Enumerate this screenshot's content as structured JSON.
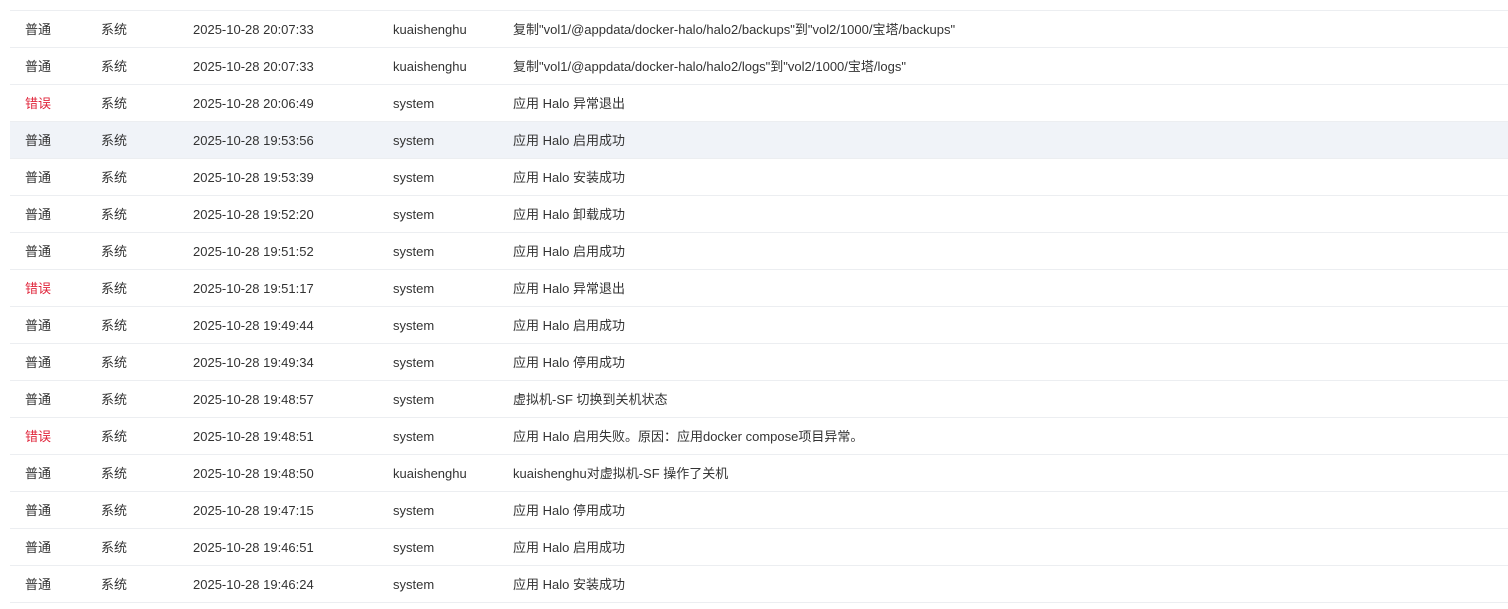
{
  "colors": {
    "error_level": "#e0243a",
    "row_hover": "#f0f3f8",
    "divider": "#eceef1",
    "text": "#333333"
  },
  "log": {
    "rows": [
      {
        "level": "普通",
        "type": "系统",
        "time": "2025-10-28 20:07:33",
        "user": "kuaishenghu",
        "message": "复制\"vol1/@appdata/docker-halo/halo2/backups\"到\"vol2/1000/宝塔/backups\"",
        "is_error": false,
        "hover": false
      },
      {
        "level": "普通",
        "type": "系统",
        "time": "2025-10-28 20:07:33",
        "user": "kuaishenghu",
        "message": "复制\"vol1/@appdata/docker-halo/halo2/logs\"到\"vol2/1000/宝塔/logs\"",
        "is_error": false,
        "hover": false
      },
      {
        "level": "错误",
        "type": "系统",
        "time": "2025-10-28 20:06:49",
        "user": "system",
        "message": "应用 Halo 异常退出",
        "is_error": true,
        "hover": false
      },
      {
        "level": "普通",
        "type": "系统",
        "time": "2025-10-28 19:53:56",
        "user": "system",
        "message": "应用 Halo 启用成功",
        "is_error": false,
        "hover": true
      },
      {
        "level": "普通",
        "type": "系统",
        "time": "2025-10-28 19:53:39",
        "user": "system",
        "message": "应用 Halo 安装成功",
        "is_error": false,
        "hover": false
      },
      {
        "level": "普通",
        "type": "系统",
        "time": "2025-10-28 19:52:20",
        "user": "system",
        "message": "应用 Halo 卸载成功",
        "is_error": false,
        "hover": false
      },
      {
        "level": "普通",
        "type": "系统",
        "time": "2025-10-28 19:51:52",
        "user": "system",
        "message": "应用 Halo 启用成功",
        "is_error": false,
        "hover": false
      },
      {
        "level": "错误",
        "type": "系统",
        "time": "2025-10-28 19:51:17",
        "user": "system",
        "message": "应用 Halo 异常退出",
        "is_error": true,
        "hover": false
      },
      {
        "level": "普通",
        "type": "系统",
        "time": "2025-10-28 19:49:44",
        "user": "system",
        "message": "应用 Halo 启用成功",
        "is_error": false,
        "hover": false
      },
      {
        "level": "普通",
        "type": "系统",
        "time": "2025-10-28 19:49:34",
        "user": "system",
        "message": "应用 Halo 停用成功",
        "is_error": false,
        "hover": false
      },
      {
        "level": "普通",
        "type": "系统",
        "time": "2025-10-28 19:48:57",
        "user": "system",
        "message": "虚拟机-SF 切换到关机状态",
        "is_error": false,
        "hover": false
      },
      {
        "level": "错误",
        "type": "系统",
        "time": "2025-10-28 19:48:51",
        "user": "system",
        "message": "应用 Halo 启用失败。原因：应用docker compose项目异常。",
        "is_error": true,
        "hover": false
      },
      {
        "level": "普通",
        "type": "系统",
        "time": "2025-10-28 19:48:50",
        "user": "kuaishenghu",
        "message": "kuaishenghu对虚拟机-SF 操作了关机",
        "is_error": false,
        "hover": false
      },
      {
        "level": "普通",
        "type": "系统",
        "time": "2025-10-28 19:47:15",
        "user": "system",
        "message": "应用 Halo 停用成功",
        "is_error": false,
        "hover": false
      },
      {
        "level": "普通",
        "type": "系统",
        "time": "2025-10-28 19:46:51",
        "user": "system",
        "message": "应用 Halo 启用成功",
        "is_error": false,
        "hover": false
      },
      {
        "level": "普通",
        "type": "系统",
        "time": "2025-10-28 19:46:24",
        "user": "system",
        "message": "应用 Halo 安装成功",
        "is_error": false,
        "hover": false
      }
    ]
  }
}
